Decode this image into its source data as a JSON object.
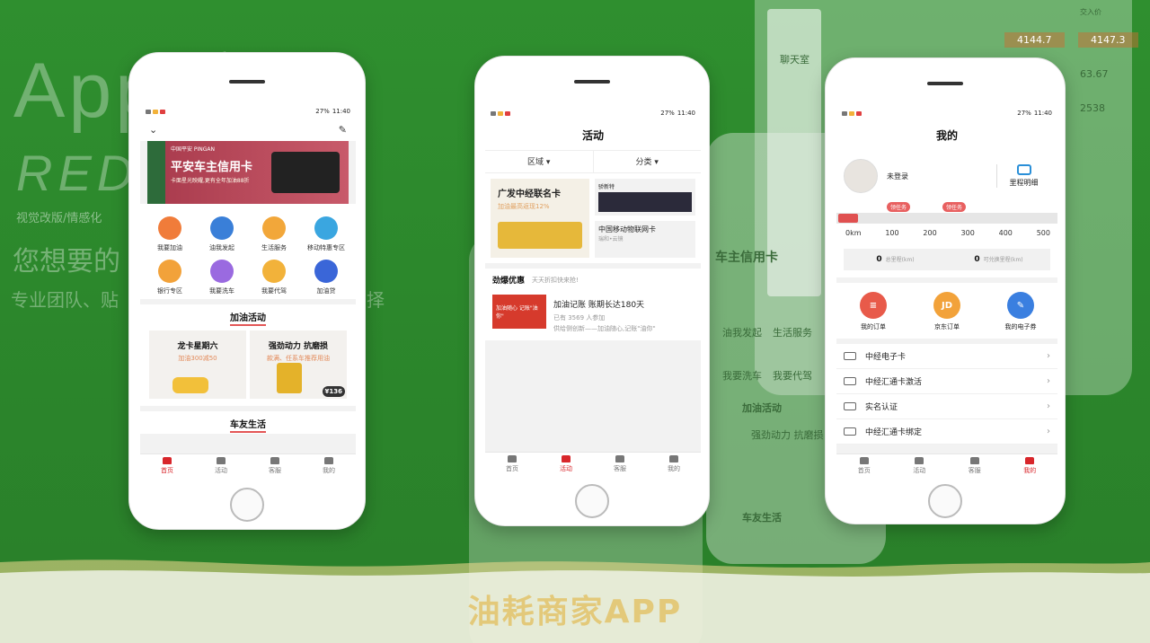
{
  "background": {
    "title": "App 定制",
    "subtitle": "RED",
    "line1": "视觉改版/情感化",
    "line2": "您想要的",
    "line3": "专业团队、贴",
    "line3_end": "择"
  },
  "footer_title": "油耗商家APP",
  "status": {
    "battery": "27%",
    "time": "11:40"
  },
  "phone1": {
    "banner": {
      "logo": "中国平安 PINGAN",
      "title": "平安车主信用卡",
      "subtitle": "卡面星光映耀,更有全年加油88折"
    },
    "icons": [
      {
        "label": "我要加油",
        "color": "#f07c3a"
      },
      {
        "label": "油我发起",
        "color": "#3a7fd8"
      },
      {
        "label": "生活服务",
        "color": "#f2a73a"
      },
      {
        "label": "移动特惠专区",
        "color": "#3aa6e0"
      },
      {
        "label": "银行专区",
        "color": "#f2a23a"
      },
      {
        "label": "我要洗车",
        "color": "#9a6ae0"
      },
      {
        "label": "我要代驾",
        "color": "#f2b23a"
      },
      {
        "label": "加油贷",
        "color": "#3a66d8"
      }
    ],
    "section1": "加油活动",
    "promos": [
      {
        "title": "龙卡星期六",
        "sub": "加油300减50"
      },
      {
        "title": "强劲动力 抗磨损",
        "sub": "款满、任系车推荐用油",
        "price": "¥136"
      }
    ],
    "section2": "车友生活",
    "tabs": [
      "首页",
      "活动",
      "客服",
      "我的"
    ]
  },
  "phone2": {
    "header": "活动",
    "filters": [
      "区域",
      "分类"
    ],
    "bigcard": {
      "title": "广发中经联名卡",
      "sub": "加油最高返现12%"
    },
    "smallcards": [
      {
        "title": "骄新特",
        "sub": ""
      },
      {
        "title": "中国移动物联网卡",
        "sub": "瑞和•云镜"
      }
    ],
    "deals_title": "劲爆优惠",
    "deals_sub": "天天折扣快来抢!",
    "deal": {
      "title": "加油记账 账期长达180天",
      "joined": "已有 3569 人参加",
      "desc": "供给侧创新——加油随心,记账\"油你\"",
      "img_text": "加油随心 记账\"油你\""
    },
    "tabs": [
      "首页",
      "活动",
      "客服",
      "我的"
    ]
  },
  "phone3": {
    "header": "我的",
    "user": "未登录",
    "mileage": "里程明细",
    "flags": [
      "领任务",
      "领任务"
    ],
    "ticks": [
      "0km",
      "100",
      "200",
      "300",
      "400",
      "500"
    ],
    "stats": [
      {
        "value": "0",
        "label": "总里程(km)"
      },
      {
        "value": "0",
        "label": "可兑换里程(km)"
      }
    ],
    "orders": [
      {
        "label": "我的订单",
        "color": "#e85a4a",
        "glyph": "≡"
      },
      {
        "label": "京东订单",
        "color": "#f2a23a",
        "glyph": "JD"
      },
      {
        "label": "我的电子券",
        "color": "#3a7fe0",
        "glyph": "✎"
      }
    ],
    "menu": [
      "中经电子卡",
      "中经汇通卡激活",
      "实名认证",
      "中经汇通卡绑定"
    ],
    "tabs": [
      "首页",
      "活动",
      "客服",
      "我的"
    ]
  },
  "ghost": {
    "chat": "聊天室",
    "values": [
      "4144.7",
      "4147.3",
      "63.67",
      "2538"
    ],
    "header": "交入价",
    "card_title": "车主信用卡",
    "icons": [
      "油我发起",
      "生活服务",
      "我要洗车",
      "我要代驾"
    ],
    "section1": "加油活动",
    "promo": "强劲动力 抗磨损",
    "section2": "车友生活"
  }
}
